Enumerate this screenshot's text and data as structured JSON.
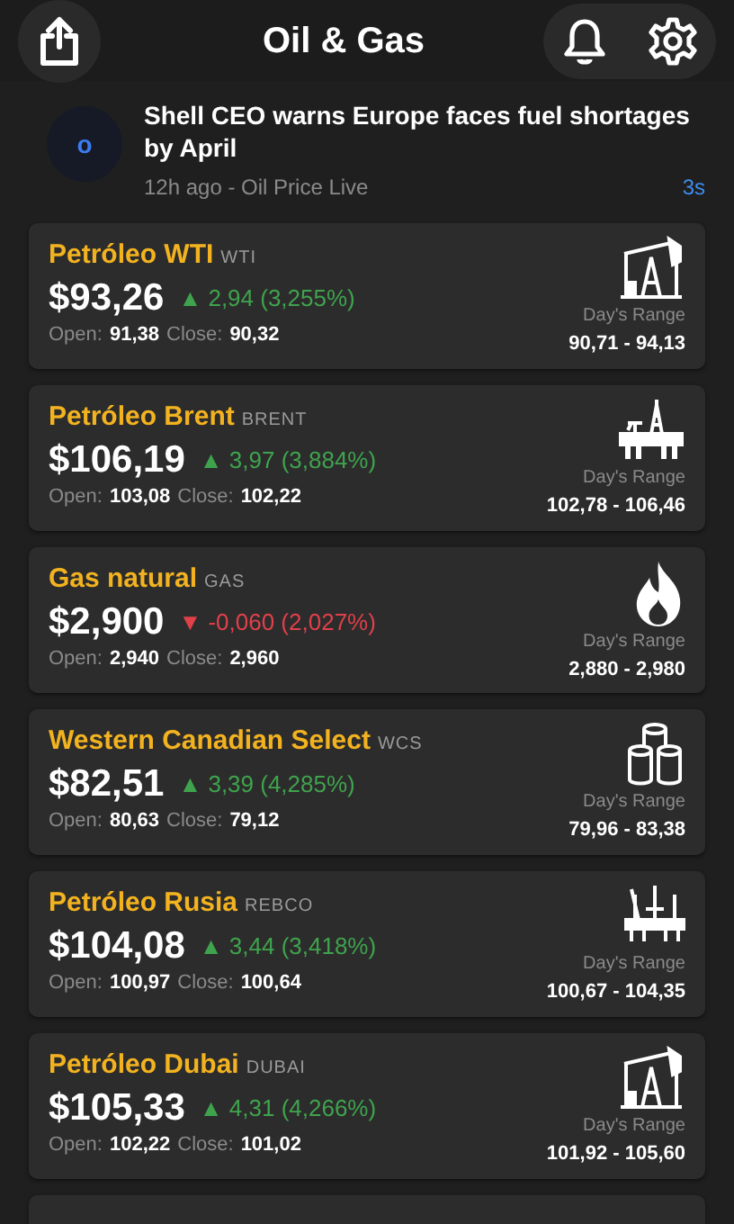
{
  "header": {
    "title": "Oil & Gas"
  },
  "news": {
    "avatar": "o",
    "headline": "Shell CEO warns Europe faces fuel shortages by April",
    "meta": "12h ago - Oil Price Live",
    "age": "3s"
  },
  "quotes": [
    {
      "kind": "pumpjack",
      "name": "Petróleo WTI",
      "symbol": "WTI",
      "price": "$93,26",
      "change": {
        "kind": "up",
        "arrow": "▲",
        "text": "2,94 (3,255%)"
      },
      "open_label": "Open:",
      "open": "91,38",
      "close_label": "Close:",
      "close": "90,32",
      "range_label": "Day's Range",
      "range": "90,71 - 94,13"
    },
    {
      "kind": "rig",
      "name": "Petróleo Brent",
      "symbol": "BRENT",
      "price": "$106,19",
      "change": {
        "kind": "up",
        "arrow": "▲",
        "text": "3,97 (3,884%)"
      },
      "open_label": "Open:",
      "open": "103,08",
      "close_label": "Close:",
      "close": "102,22",
      "range_label": "Day's Range",
      "range": "102,78 - 106,46"
    },
    {
      "kind": "flame",
      "name": "Gas natural",
      "symbol": "GAS",
      "price": "$2,900",
      "change": {
        "kind": "down",
        "arrow": "▼",
        "text": "-0,060 (2,027%)"
      },
      "open_label": "Open:",
      "open": "2,940",
      "close_label": "Close:",
      "close": "2,960",
      "range_label": "Day's Range",
      "range": "2,880 - 2,980"
    },
    {
      "kind": "barrels",
      "name": "Western Canadian Select",
      "symbol": "WCS",
      "price": "$82,51",
      "change": {
        "kind": "up",
        "arrow": "▲",
        "text": "3,39 (4,285%)"
      },
      "open_label": "Open:",
      "open": "80,63",
      "close_label": "Close:",
      "close": "79,12",
      "range_label": "Day's Range",
      "range": "79,96 - 83,38"
    },
    {
      "kind": "platform",
      "name": "Petróleo Rusia",
      "symbol": "REBCO",
      "price": "$104,08",
      "change": {
        "kind": "up",
        "arrow": "▲",
        "text": "3,44 (3,418%)"
      },
      "open_label": "Open:",
      "open": "100,97",
      "close_label": "Close:",
      "close": "100,64",
      "range_label": "Day's Range",
      "range": "100,67 - 104,35"
    },
    {
      "kind": "pumpjack",
      "name": "Petróleo Dubai",
      "symbol": "DUBAI",
      "price": "$105,33",
      "change": {
        "kind": "up",
        "arrow": "▲",
        "text": "4,31 (4,266%)"
      },
      "open_label": "Open:",
      "open": "102,22",
      "close_label": "Close:",
      "close": "101,02",
      "range_label": "Day's Range",
      "range": "101,92 - 105,60"
    }
  ]
}
